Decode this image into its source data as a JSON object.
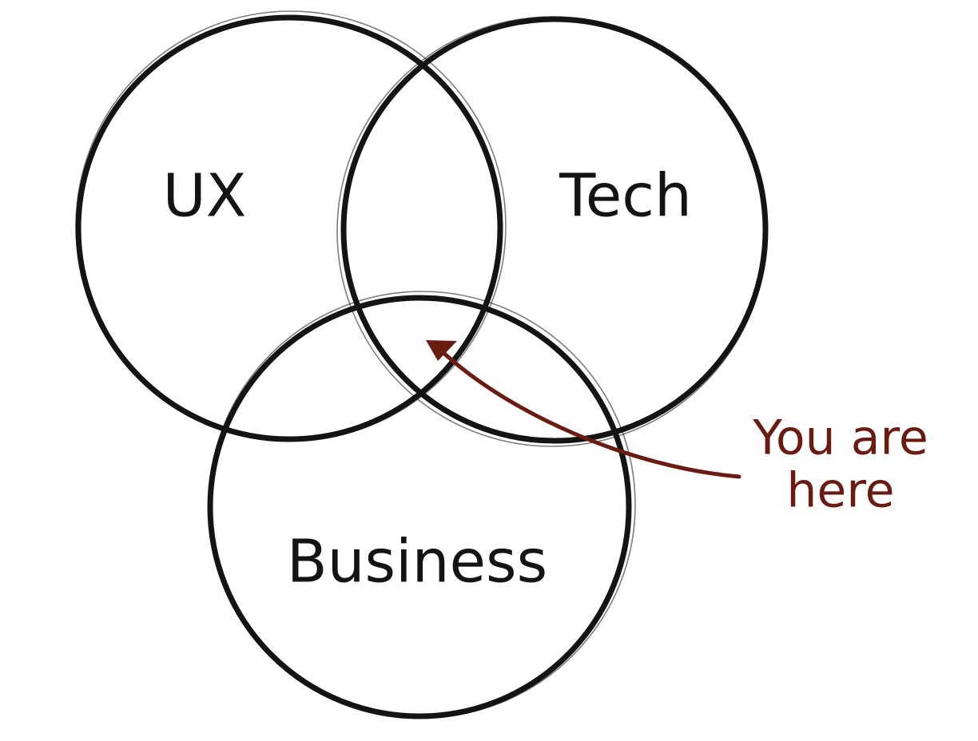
{
  "sets": [
    {
      "id": "ux",
      "label": "UX"
    },
    {
      "id": "tech",
      "label": "Tech"
    },
    {
      "id": "business",
      "label": "Business"
    }
  ],
  "annotation": {
    "line1": "You are",
    "line2": "here",
    "color": "#6b1c12"
  },
  "ink_color": "#141414"
}
